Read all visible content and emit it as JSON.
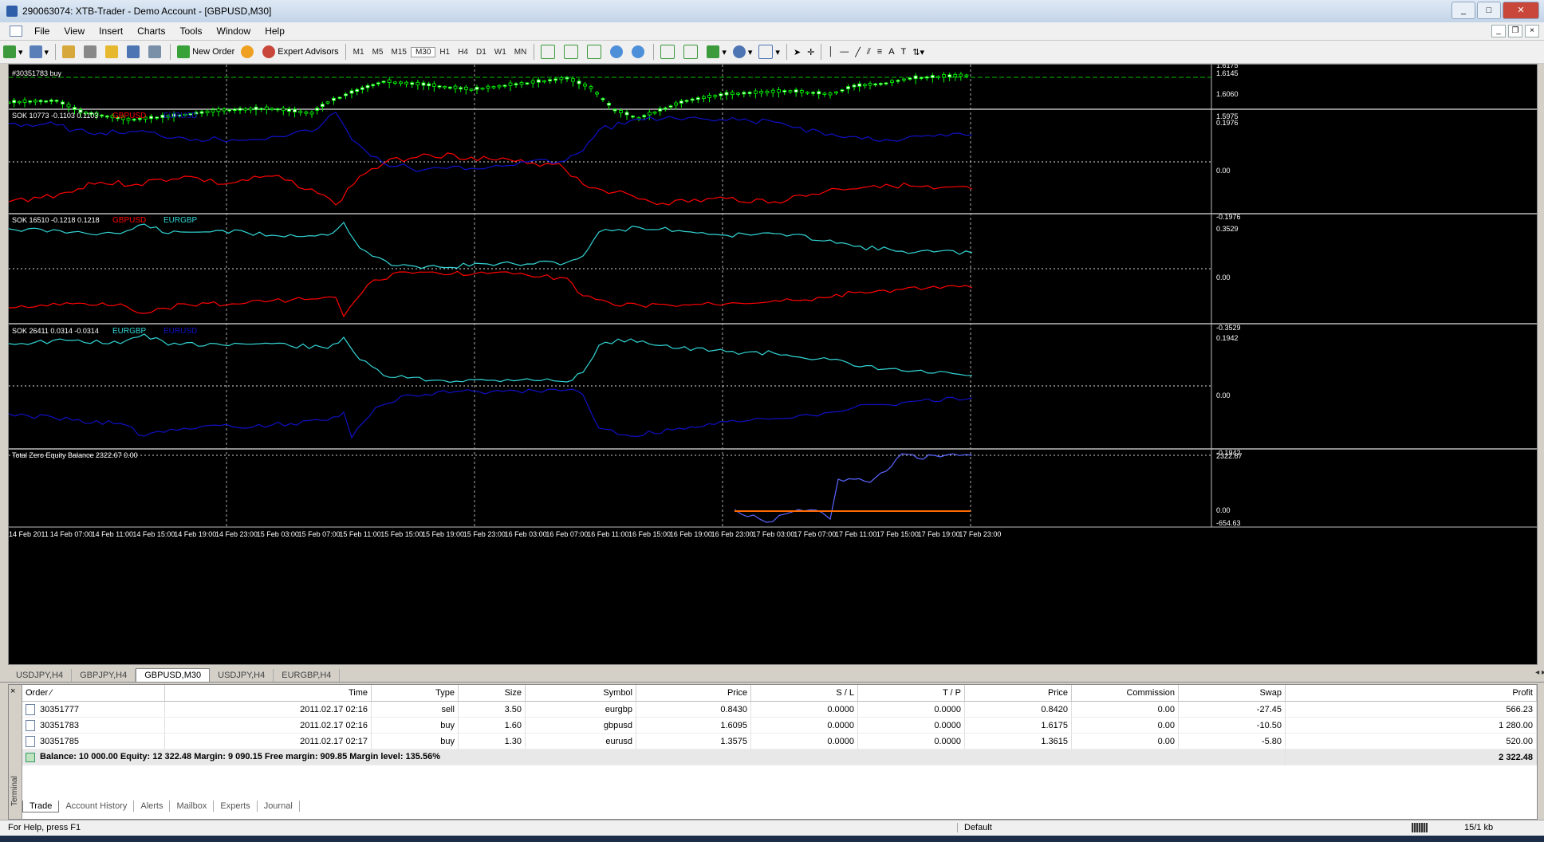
{
  "window": {
    "title": "290063074: XTB-Trader - Demo Account - [GBPUSD,M30]"
  },
  "menu": [
    "File",
    "View",
    "Insert",
    "Charts",
    "Tools",
    "Window",
    "Help"
  ],
  "toolbar": {
    "new_order": "New Order",
    "expert_advisors": "Expert Advisors",
    "timeframes": [
      "M1",
      "M5",
      "M15",
      "M30",
      "H1",
      "H4",
      "D1",
      "W1",
      "MN"
    ]
  },
  "chart": {
    "main": {
      "order_label": "#30351783 buy",
      "price_labels": [
        "1.6175",
        "1.6145",
        "1.6060",
        "1.5975"
      ]
    },
    "indicators": [
      {
        "label": "SOK 10773 -0.1103 0.1103",
        "sym1": "GBPUSD",
        "sym2": "EURUSD",
        "scale": [
          "0.1976",
          "0.00",
          "-0.1976"
        ]
      },
      {
        "label": "SOK 16510 -0.1218 0.1218",
        "sym1": "GBPUSD",
        "sym2": "EURGBP",
        "scale": [
          "0.3529",
          "0.00",
          "-0.3529"
        ]
      },
      {
        "label": "SOK 26411 0.0314 -0.0314",
        "sym1": "EURGBP",
        "sym2": "EURUSD",
        "scale": [
          "0.1942",
          "0.00",
          "-0.1942"
        ]
      },
      {
        "label": "Total Zero Equity Balance 2322.67 0.00",
        "scale": [
          "2322.67",
          "0.00",
          "-654.63"
        ]
      }
    ],
    "time_axis": [
      "14 Feb 2011",
      "14 Feb 07:00",
      "14 Feb 11:00",
      "14 Feb 15:00",
      "14 Feb 19:00",
      "14 Feb 23:00",
      "15 Feb 03:00",
      "15 Feb 07:00",
      "15 Feb 11:00",
      "15 Feb 15:00",
      "15 Feb 19:00",
      "15 Feb 23:00",
      "16 Feb 03:00",
      "16 Feb 07:00",
      "16 Feb 11:00",
      "16 Feb 15:00",
      "16 Feb 19:00",
      "16 Feb 23:00",
      "17 Feb 03:00",
      "17 Feb 07:00",
      "17 Feb 11:00",
      "17 Feb 15:00",
      "17 Feb 19:00",
      "17 Feb 23:00"
    ],
    "colors": {
      "red": "#ff0000",
      "blue": "#1010c8",
      "cyan": "#33d6d6",
      "green": "#00ff00",
      "orange": "#ff6a00"
    }
  },
  "chart_tabs": [
    "USDJPY,H4",
    "GBPJPY,H4",
    "GBPUSD,M30",
    "USDJPY,H4",
    "EURGBP,H4"
  ],
  "chart_tabs_active": "GBPUSD,M30",
  "terminal": {
    "side_label": "Terminal",
    "columns": [
      "Order",
      "Time",
      "Type",
      "Size",
      "Symbol",
      "Price",
      "S / L",
      "T / P",
      "Price",
      "Commission",
      "Swap",
      "Profit"
    ],
    "rows": [
      [
        "30351777",
        "2011.02.17 02:16",
        "sell",
        "3.50",
        "eurgbp",
        "0.8430",
        "0.0000",
        "0.0000",
        "0.8420",
        "0.00",
        "-27.45",
        "566.23"
      ],
      [
        "30351783",
        "2011.02.17 02:16",
        "buy",
        "1.60",
        "gbpusd",
        "1.6095",
        "0.0000",
        "0.0000",
        "1.6175",
        "0.00",
        "-10.50",
        "1 280.00"
      ],
      [
        "30351785",
        "2011.02.17 02:17",
        "buy",
        "1.30",
        "eurusd",
        "1.3575",
        "0.0000",
        "0.0000",
        "1.3615",
        "0.00",
        "-5.80",
        "520.00"
      ]
    ],
    "summary": "Balance: 10 000.00  Equity: 12 322.48  Margin: 9 090.15  Free margin: 909.85  Margin level: 135.56%",
    "summary_profit": "2 322.48",
    "tabs": [
      "Trade",
      "Account History",
      "Alerts",
      "Mailbox",
      "Experts",
      "Journal"
    ]
  },
  "status": {
    "help": "For Help, press F1",
    "profile": "Default",
    "traffic": "15/1 kb"
  }
}
